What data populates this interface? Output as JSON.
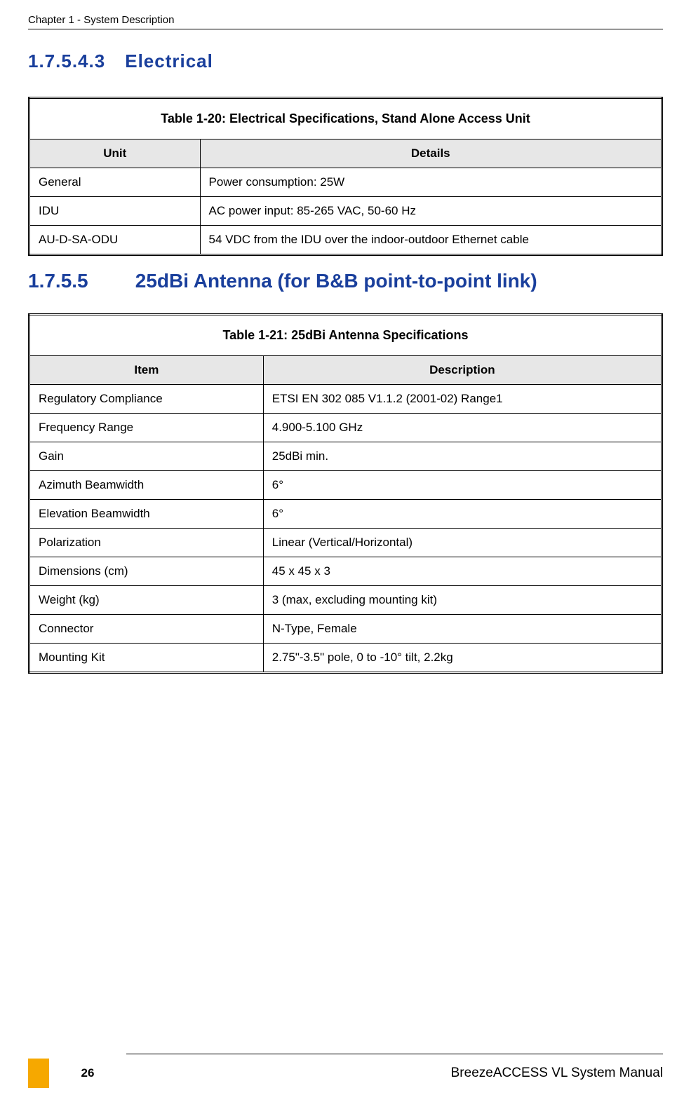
{
  "header": {
    "chapter": "Chapter 1 - System Description"
  },
  "section1": {
    "number": "1.7.5.4.3",
    "title": "Electrical"
  },
  "table1": {
    "caption": "Table 1-20: Electrical Specifications, Stand Alone Access Unit",
    "col1": "Unit",
    "col2": "Details",
    "rows": [
      {
        "c1": "General",
        "c2": "Power consumption: 25W"
      },
      {
        "c1": "IDU",
        "c2": "AC power input: 85-265 VAC, 50-60 Hz"
      },
      {
        "c1": "AU-D-SA-ODU",
        "c2": "54 VDC from the IDU over the indoor-outdoor Ethernet cable"
      }
    ]
  },
  "section2": {
    "number": "1.7.5.5",
    "title": "25dBi Antenna (for B&B point-to-point link)"
  },
  "table2": {
    "caption": "Table 1-21: 25dBi Antenna Specifications",
    "col1": "Item",
    "col2": "Description",
    "rows": [
      {
        "c1": "Regulatory Compliance",
        "c2": "ETSI EN 302 085 V1.1.2 (2001-02) Range1"
      },
      {
        "c1": "Frequency Range",
        "c2": "4.900-5.100 GHz"
      },
      {
        "c1": "Gain",
        "c2": "25dBi min."
      },
      {
        "c1": "Azimuth Beamwidth",
        "c2": "6°"
      },
      {
        "c1": "Elevation Beamwidth",
        "c2": "6°"
      },
      {
        "c1": "Polarization",
        "c2": "Linear (Vertical/Horizontal)"
      },
      {
        "c1": "Dimensions (cm)",
        "c2": "45 x 45 x 3"
      },
      {
        "c1": "Weight (kg)",
        "c2": "3 (max, excluding mounting kit)"
      },
      {
        "c1": "Connector",
        "c2": "N-Type, Female"
      },
      {
        "c1": "Mounting Kit",
        "c2": "2.75\"-3.5\" pole, 0 to -10° tilt, 2.2kg"
      }
    ]
  },
  "footer": {
    "page": "26",
    "title": "BreezeACCESS VL System Manual"
  }
}
